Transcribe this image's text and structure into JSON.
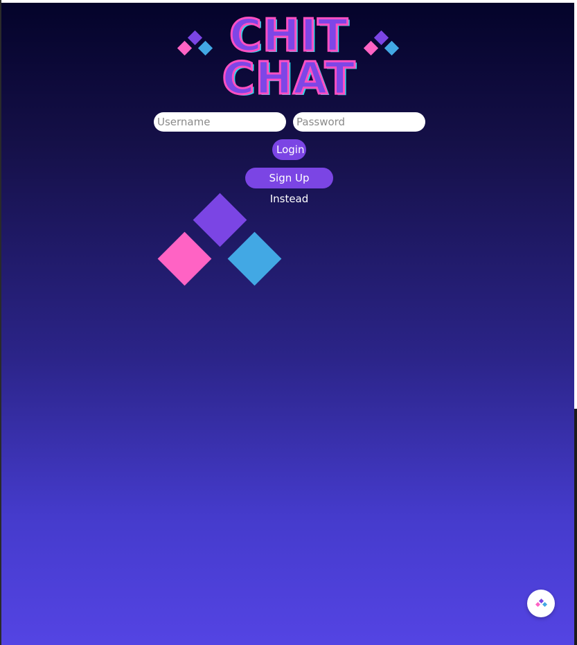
{
  "logo": {
    "line1": "CHIT",
    "line2": "CHAT",
    "colors": {
      "fill": "#7e46e6",
      "stroke": "#ff4fc3",
      "shadow": "#2fd6ea"
    }
  },
  "login_form": {
    "username_placeholder": "Username",
    "password_placeholder": "Password",
    "username_value": "",
    "password_value": "",
    "login_label": "Login",
    "signup_label": "Sign Up Instead"
  },
  "brand_colors": {
    "purple": "#7b45e4",
    "pink": "#ff63c4",
    "blue": "#42a8e4",
    "background_top": "#04032a",
    "background_bottom": "#5444e3"
  },
  "icons": {
    "logo_decoration_left": "diamond-cluster-icon",
    "logo_decoration_right": "diamond-cluster-icon",
    "hero": "diamond-cluster-icon",
    "floating_button": "diamond-cluster-icon"
  }
}
